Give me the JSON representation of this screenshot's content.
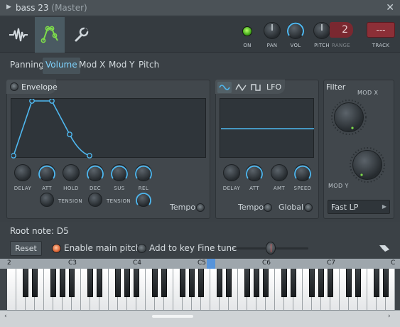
{
  "window": {
    "title": "bass 23",
    "subtitle": "(Master)",
    "close_glyph": "✕",
    "collapse_glyph": "▶"
  },
  "toolbar": {
    "icons": [
      "waveform-icon",
      "envelope-icon",
      "wrench-icon"
    ],
    "on_label": "ON",
    "pan_label": "PAN",
    "vol_label": "VOL",
    "pitch_label": "PITCH",
    "range_label": "RANGE",
    "range_value": "2",
    "track_label": "TRACK",
    "track_value": "---"
  },
  "tabs": [
    {
      "label": "Panning",
      "active": false
    },
    {
      "label": "Volume",
      "active": true
    },
    {
      "label": "Mod X",
      "active": false
    },
    {
      "label": "Mod Y",
      "active": false
    },
    {
      "label": "Pitch",
      "active": false
    }
  ],
  "envelope": {
    "title": "Envelope",
    "knobs": [
      "DELAY",
      "ATT",
      "HOLD",
      "DEC",
      "SUS",
      "REL"
    ],
    "tension_label": "TENSION",
    "tempo_label": "Tempo"
  },
  "lfo": {
    "title": "LFO",
    "shapes": [
      "sine-icon",
      "triangle-icon",
      "square-icon"
    ],
    "knobs": [
      "DELAY",
      "ATT",
      "AMT",
      "SPEED"
    ],
    "tempo_label": "Tempo",
    "global_label": "Global"
  },
  "filter": {
    "title": "Filter",
    "mod_x_label": "MOD X",
    "mod_y_label": "MOD Y",
    "type_value": "Fast LP"
  },
  "root": {
    "label": "Root note: D5",
    "reset_label": "Reset",
    "enable_pitch_label": "Enable main pitch",
    "add_key_label": "Add to key",
    "fine_tune_label": "Fine tune"
  },
  "keyboard": {
    "octave_labels": [
      "2",
      "C3",
      "C4",
      "C5",
      "C6",
      "C7",
      "C"
    ],
    "highlighted_note": "D5"
  },
  "colors": {
    "accent_blue": "#4fb8f0",
    "led_green": "#6ad13a",
    "range_red": "#7a2830",
    "track_red": "#8c2f37",
    "enable_orange": "#e06a3a"
  }
}
